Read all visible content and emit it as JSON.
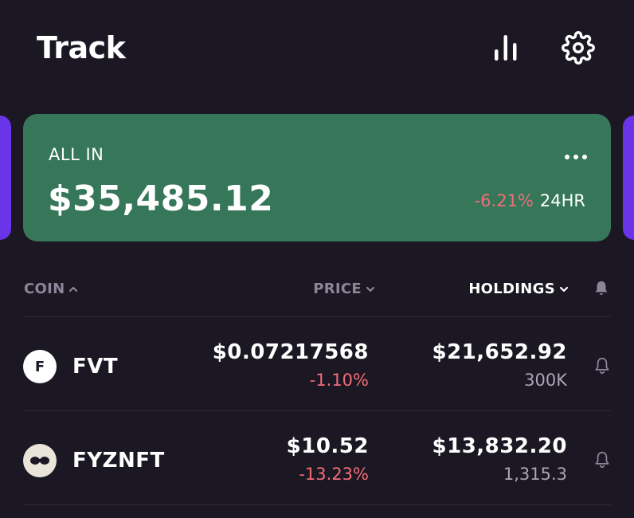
{
  "header": {
    "title": "Track",
    "icons": [
      "stats-icon",
      "settings-gear-icon"
    ]
  },
  "portfolio_card": {
    "label": "ALL IN",
    "value": "$35,485.12",
    "change_percent": "-6.21%",
    "change_period": "24HR",
    "background_color": "#367759",
    "more_icon": "more-horizontal-icon"
  },
  "columns": {
    "coin": "COIN",
    "price": "PRICE",
    "holdings": "HOLDINGS",
    "active_sort": "holdings",
    "alert_icon": "bell-filled-icon"
  },
  "coins": [
    {
      "symbol": "FVT",
      "icon_letter": "F",
      "price": "$0.07217568",
      "change": "-1.10%",
      "holdings_value": "$21,652.92",
      "holdings_qty": "300K"
    },
    {
      "symbol": "FYZNFT",
      "icon_letter": "",
      "price": "$10.52",
      "change": "-13.23%",
      "holdings_value": "$13,832.20",
      "holdings_qty": "1,315.3"
    }
  ],
  "colors": {
    "background": "#1b1723",
    "negative": "#f26d78",
    "accent_peek": "#6a35e8"
  }
}
